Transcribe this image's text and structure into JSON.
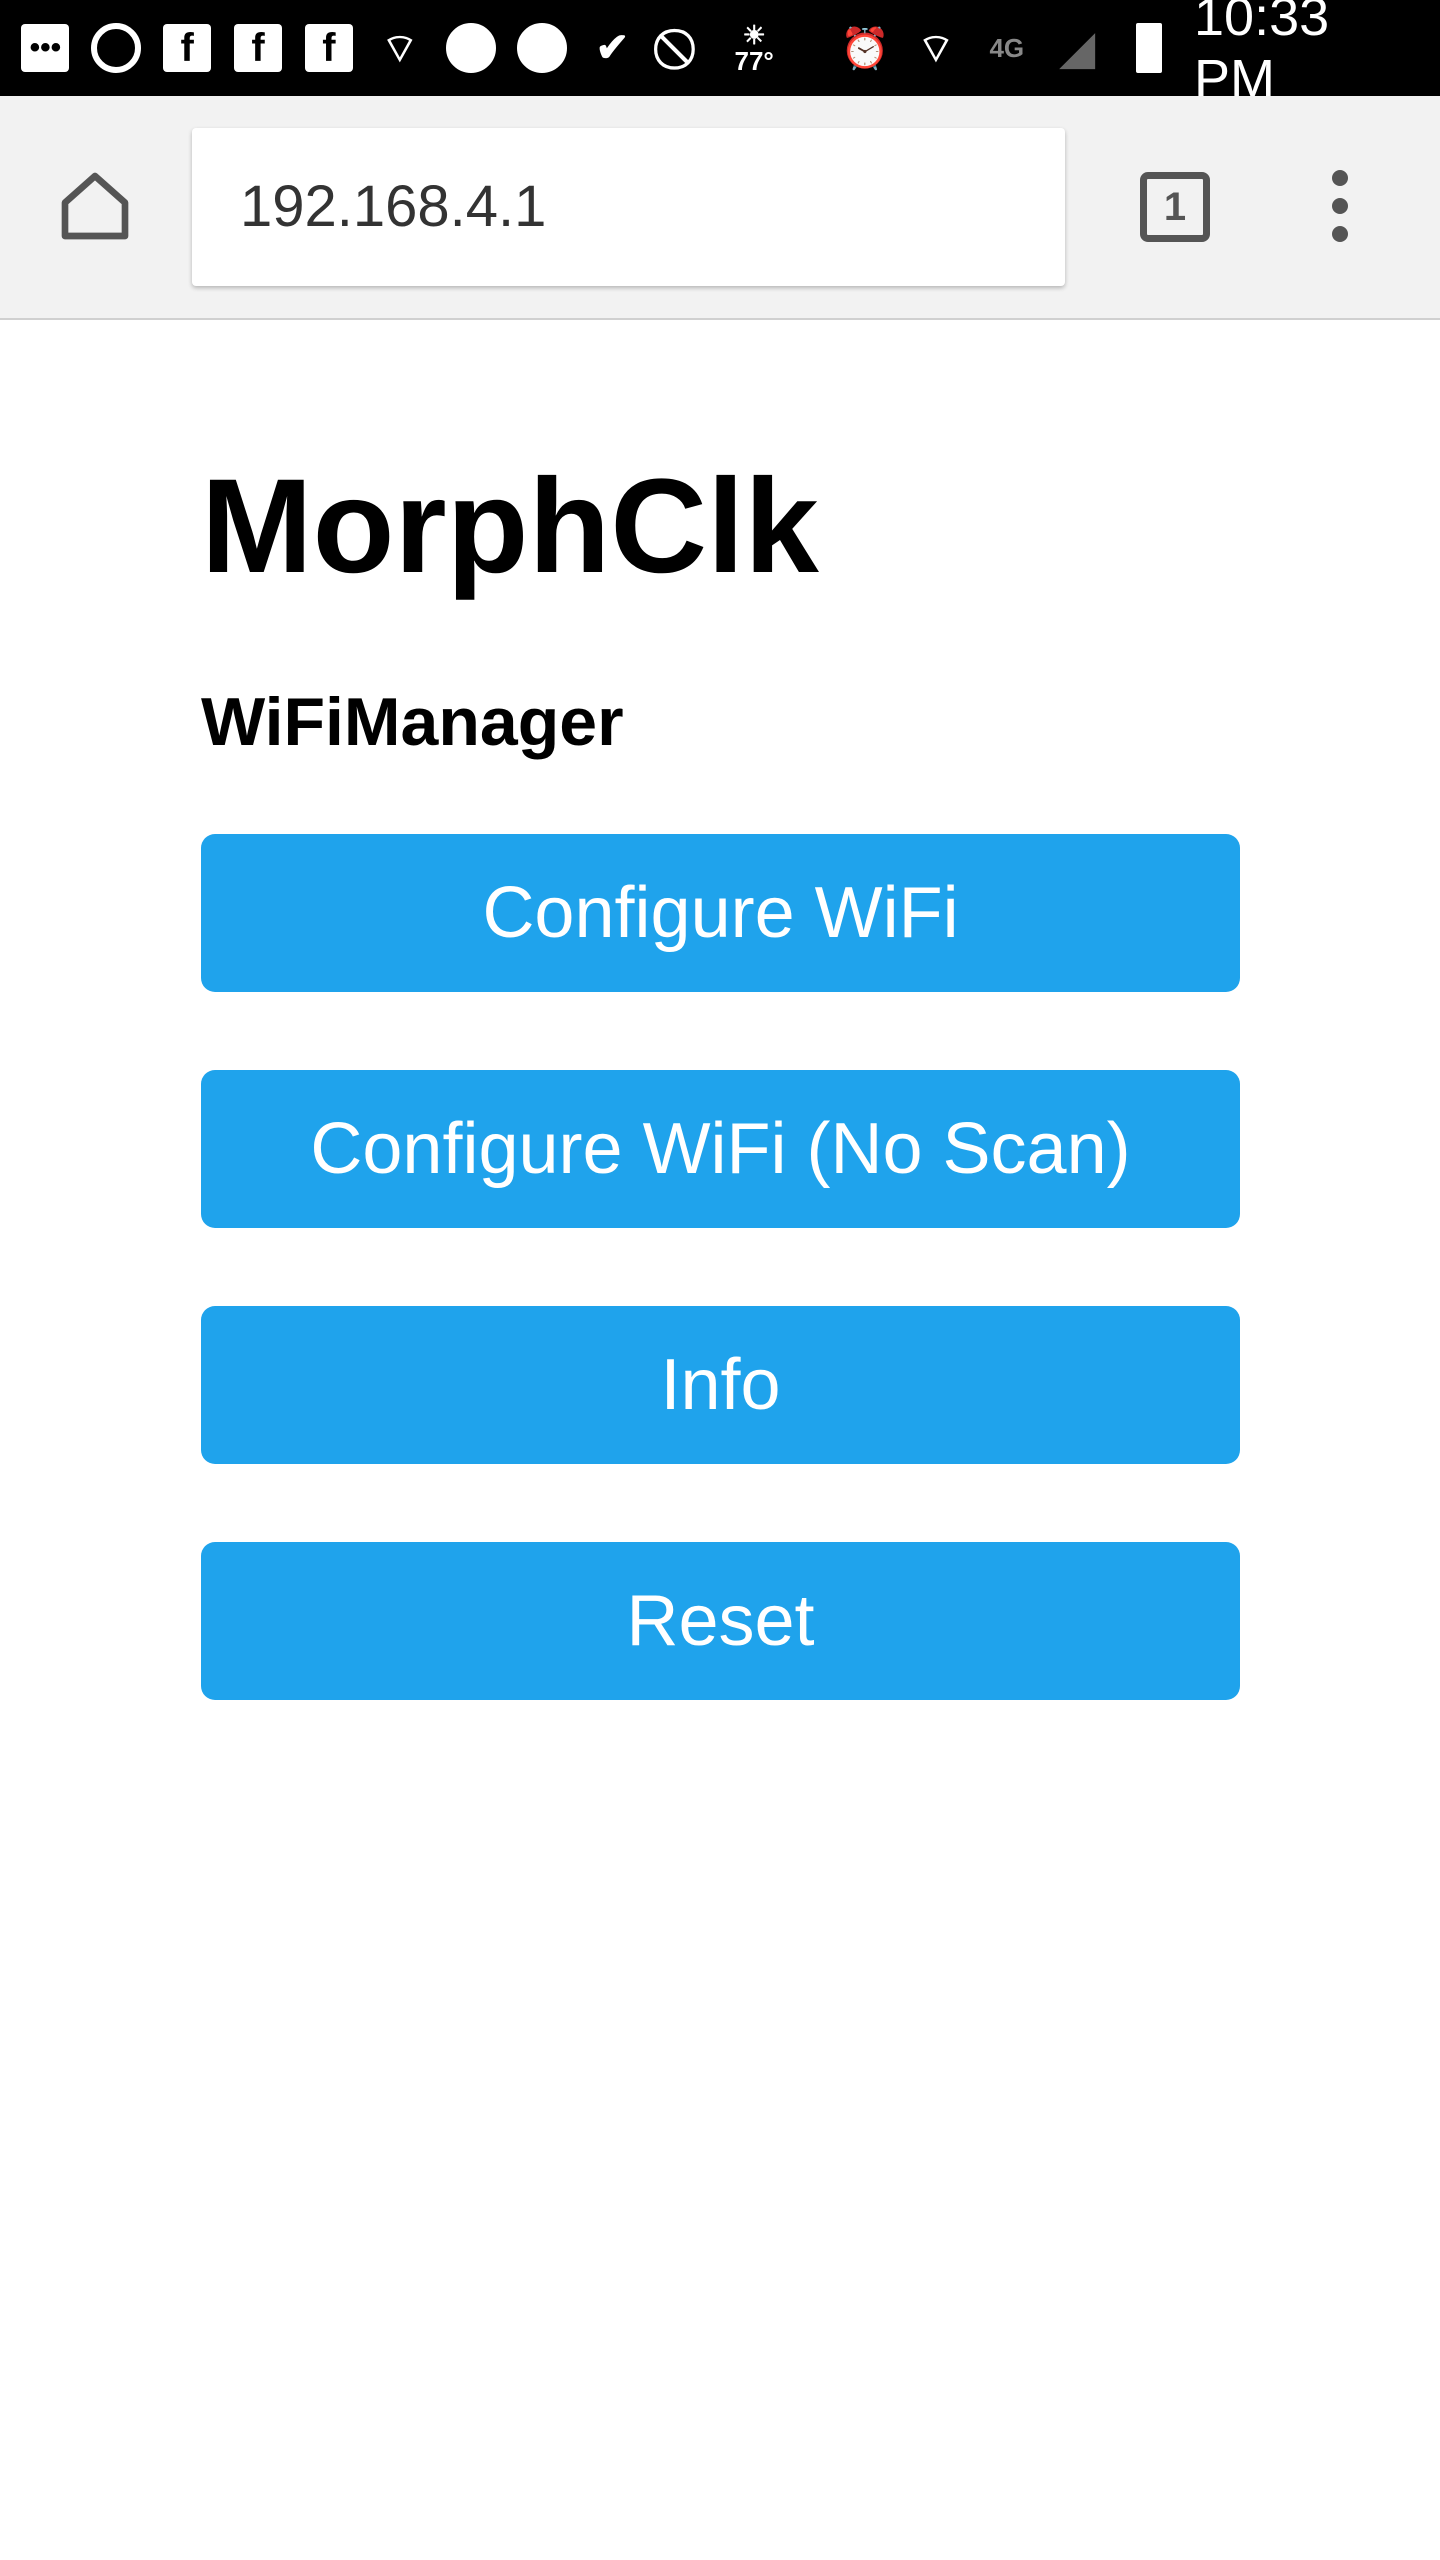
{
  "status_bar": {
    "icons": [
      "more-notifications-icon",
      "chat-icon",
      "facebook-icon",
      "facebook-icon",
      "facebook-icon",
      "wifi-alert-icon",
      "messenger-icon",
      "telegram-icon",
      "checkmark-app-icon",
      "do-not-disturb-icon",
      "weather-sun-icon",
      "alarm-icon",
      "wifi-alert-icon",
      "4g-lte-icon",
      "signal-icon",
      "battery-charging-icon"
    ],
    "temperature": "77°",
    "network": "4G",
    "time": "10:33 PM"
  },
  "browser": {
    "url": "192.168.4.1",
    "tab_count": "1"
  },
  "page": {
    "title": "MorphClk",
    "subtitle": "WiFiManager",
    "buttons": [
      {
        "label": "Configure WiFi"
      },
      {
        "label": "Configure WiFi (No Scan)"
      },
      {
        "label": "Info"
      },
      {
        "label": "Reset"
      }
    ]
  },
  "colors": {
    "button": "#1fa3ec",
    "button_text": "#ffffff"
  }
}
